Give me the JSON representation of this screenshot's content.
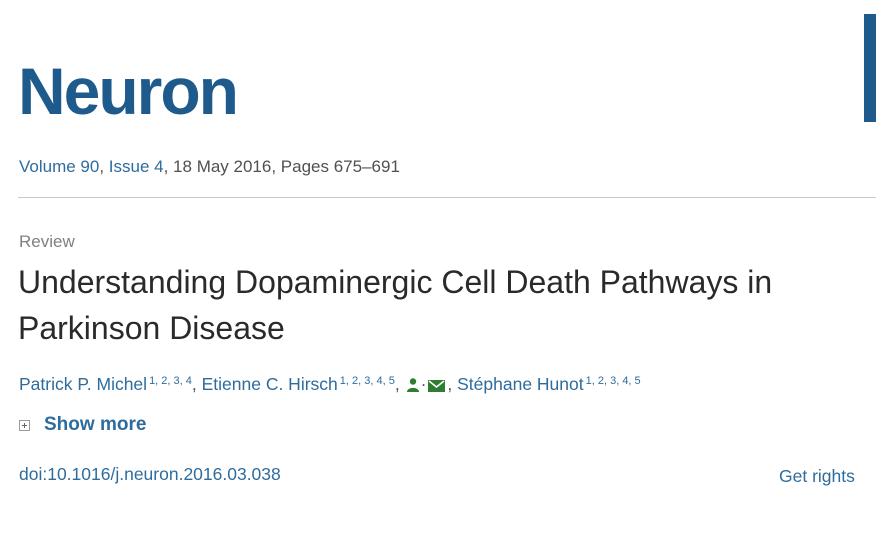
{
  "journal": {
    "name": "Neuron"
  },
  "citation": {
    "volume": "Volume 90",
    "sep1": ", ",
    "issue": "Issue 4",
    "rest": ", 18 May 2016, Pages 675–691"
  },
  "article": {
    "type": "Review",
    "title": "Understanding Dopaminergic Cell Death Pathways in Parkinson Disease"
  },
  "authors": [
    {
      "name": "Patrick P. Michel",
      "affiliations": "1, 2, 3, 4"
    },
    {
      "name": "Etienne C. Hirsch",
      "affiliations": "1, 2, 3, 4, 5"
    },
    {
      "name": "Stéphane Hunot",
      "affiliations": "1, 2, 3, 4, 5"
    }
  ],
  "separators": {
    "comma": ", ",
    "dot": "·"
  },
  "actions": {
    "show_more": "Show more",
    "doi": "doi:10.1016/j.neuron.2016.03.038",
    "get_rights": "Get rights"
  },
  "colors": {
    "brand": "#1f5a8c",
    "link": "#2e6c9e",
    "icon_green": "#2e7d32"
  }
}
